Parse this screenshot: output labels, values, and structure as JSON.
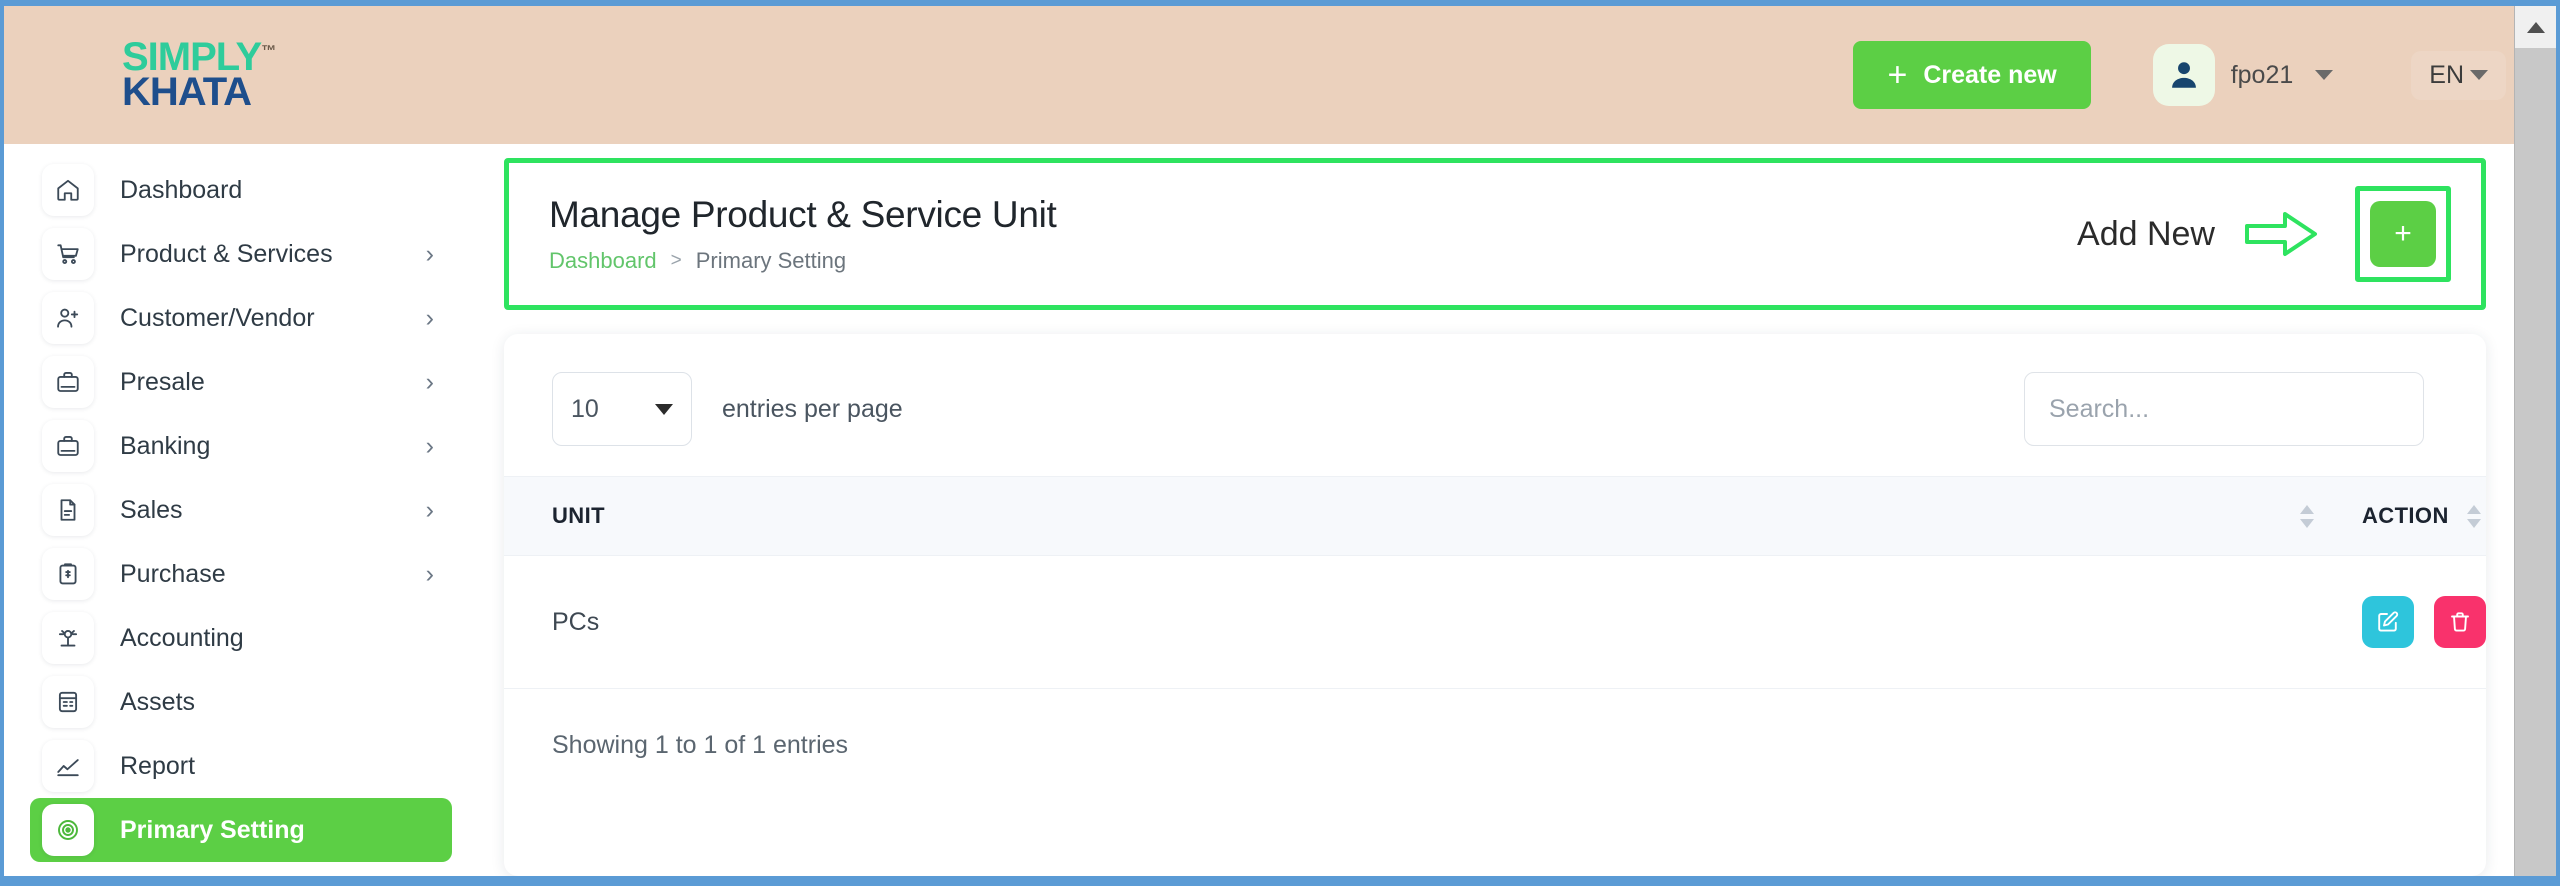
{
  "brand": {
    "line1": "SIMPLY",
    "trademark": "™",
    "line2": "KHATA"
  },
  "topbar": {
    "create_label": "Create new",
    "create_icon": "plus-icon",
    "user_name": "fpo21",
    "user_icon": "user-avatar-icon",
    "language": "EN"
  },
  "sidebar": {
    "items": [
      {
        "label": "Dashboard",
        "icon": "home-icon",
        "has_submenu": false,
        "active": false
      },
      {
        "label": "Product & Services",
        "icon": "cart-icon",
        "has_submenu": true,
        "active": false
      },
      {
        "label": "Customer/Vendor",
        "icon": "user-plus-icon",
        "has_submenu": true,
        "active": false
      },
      {
        "label": "Presale",
        "icon": "briefcase-icon",
        "has_submenu": true,
        "active": false
      },
      {
        "label": "Banking",
        "icon": "briefcase-icon",
        "has_submenu": true,
        "active": false
      },
      {
        "label": "Sales",
        "icon": "document-icon",
        "has_submenu": true,
        "active": false
      },
      {
        "label": "Purchase",
        "icon": "clipboard-icon",
        "has_submenu": true,
        "active": false
      },
      {
        "label": "Accounting",
        "icon": "scale-icon",
        "has_submenu": false,
        "active": false
      },
      {
        "label": "Assets",
        "icon": "book-icon",
        "has_submenu": false,
        "active": false
      },
      {
        "label": "Report",
        "icon": "chart-icon",
        "has_submenu": false,
        "active": false
      },
      {
        "label": "Primary Setting",
        "icon": "settings-icon",
        "has_submenu": false,
        "active": true
      }
    ],
    "submenu_glyph": "›"
  },
  "page_header": {
    "title": "Manage Product & Service Unit",
    "breadcrumb": {
      "root": "Dashboard",
      "separator": ">",
      "current": "Primary Setting"
    },
    "add_new_label": "Add New",
    "arrow_icon": "arrow-right-annotation-icon",
    "add_button_label": "+"
  },
  "table_card": {
    "per_page_value": "10",
    "per_page_label": "entries per page",
    "search_placeholder": "Search...",
    "search_value": "",
    "columns": [
      {
        "label": "UNIT",
        "sortable": true
      },
      {
        "label": "ACTION",
        "sortable": true
      }
    ],
    "rows": [
      {
        "unit": "PCs",
        "actions": [
          "edit-icon",
          "delete-icon"
        ]
      }
    ],
    "footer": "Showing 1 to 1 of 1 entries"
  },
  "colors": {
    "brand_green": "#5ccf45",
    "annotation_green": "#2ee35f",
    "header_peach": "#ebd1bd",
    "brand_teal": "#2ecc9b",
    "brand_navy": "#1e4e8c",
    "edit_cyan": "#2ec5dc",
    "delete_pink": "#f9326c",
    "frame_blue": "#5b9bd5"
  }
}
